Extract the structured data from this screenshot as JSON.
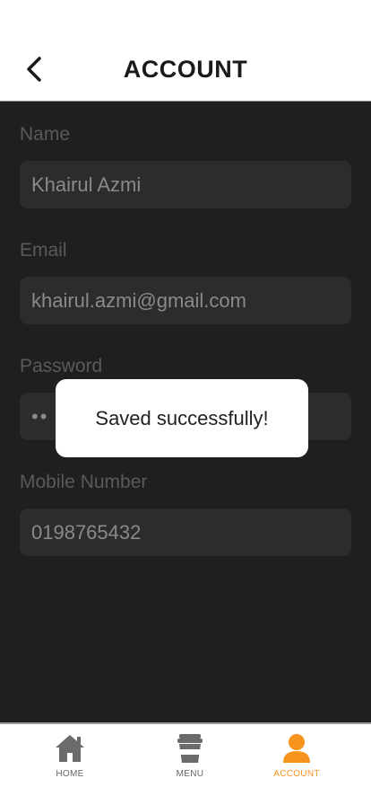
{
  "header": {
    "title": "ACCOUNT",
    "back_icon": "chevron-left-icon"
  },
  "form": {
    "name": {
      "label": "Name",
      "value": "Khairul Azmi"
    },
    "email": {
      "label": "Email",
      "value": "khairul.azmi@gmail.com"
    },
    "password": {
      "label": "Password",
      "value": "••"
    },
    "mobile": {
      "label": "Mobile Number",
      "value": "0198765432"
    }
  },
  "toast": {
    "message": "Saved successfully!"
  },
  "nav": {
    "items": [
      {
        "label": "HOME",
        "icon": "home-icon",
        "active": false
      },
      {
        "label": "MENU",
        "icon": "coffee-cup-icon",
        "active": false
      },
      {
        "label": "ACCOUNT",
        "icon": "user-icon",
        "active": true
      }
    ]
  },
  "colors": {
    "accent": "#f7931e",
    "background_dark": "#1f1f1f",
    "field_bg": "#2c2c2c",
    "label_color": "#5a5a5a",
    "nav_icon_inactive": "#6b6b6b"
  }
}
